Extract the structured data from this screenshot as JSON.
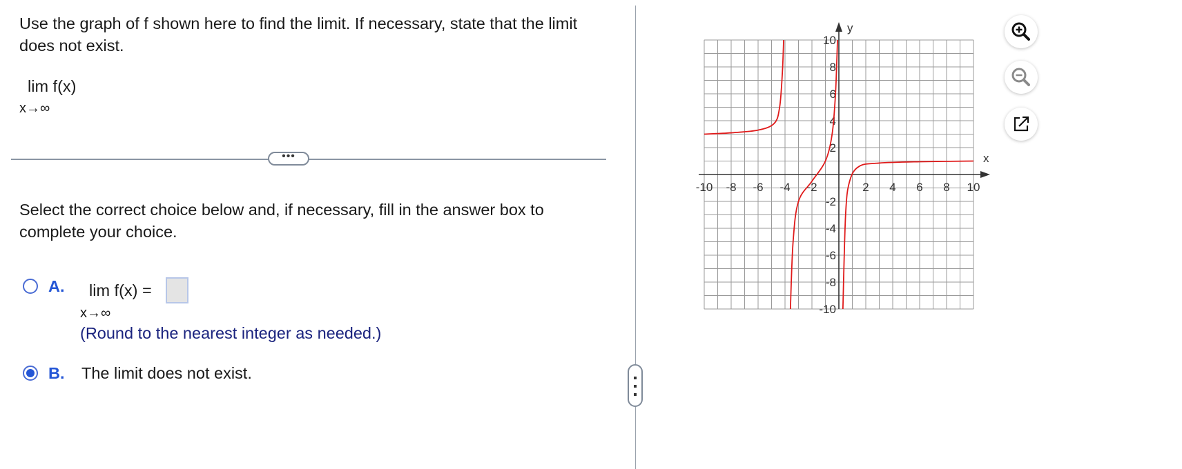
{
  "question": {
    "prompt": "Use the graph of f shown here to find the limit. If necessary, state that the limit does not exist.",
    "limit_expr": "lim  f(x)",
    "limit_sub": "x→∞"
  },
  "expander_label": "•••",
  "instructions": "Select the correct choice below and, if necessary, fill in the answer box to complete your choice.",
  "choices": [
    {
      "letter": "A.",
      "expr": "lim  f(x) =",
      "sub": "x→∞",
      "answer_value": "",
      "hint": "(Round to the nearest integer as needed.)",
      "selected": false
    },
    {
      "letter": "B.",
      "text": "The limit does not exist.",
      "selected": true
    }
  ],
  "tools": [
    "zoom-in-icon",
    "zoom-out-icon",
    "popout-icon"
  ],
  "chart_data": {
    "type": "line",
    "xlabel": "x",
    "ylabel": "y",
    "xlim": [
      -10,
      10
    ],
    "ylim": [
      -10,
      10
    ],
    "grid": true,
    "x_ticks": [
      "-10",
      "-8",
      "-6",
      "-4",
      "-2",
      "2",
      "4",
      "6",
      "8",
      "10"
    ],
    "y_ticks": [
      "10",
      "8",
      "6",
      "4",
      "2",
      "-2",
      "-4",
      "-6",
      "-8",
      "-10"
    ],
    "series": [
      {
        "color": "#e01b1b",
        "segments": [
          [
            [
              -10,
              3
            ],
            [
              -8,
              3.1
            ],
            [
              -6,
              3.3
            ],
            [
              -4.8,
              3.8
            ],
            [
              -4.4,
              5
            ],
            [
              -4.2,
              7.5
            ],
            [
              -4.1,
              10
            ]
          ],
          [
            [
              -3.6,
              -10
            ],
            [
              -3.4,
              -5
            ],
            [
              -3,
              -2
            ],
            [
              -2,
              -0.5
            ],
            [
              -1,
              1
            ],
            [
              -0.5,
              3
            ],
            [
              -0.25,
              6
            ],
            [
              -0.1,
              10
            ]
          ],
          [
            [
              0.3,
              -10
            ],
            [
              0.5,
              -3
            ],
            [
              0.8,
              -0.5
            ],
            [
              1.5,
              0.6
            ],
            [
              3,
              0.85
            ],
            [
              6,
              0.95
            ],
            [
              10,
              1
            ]
          ]
        ]
      }
    ]
  }
}
